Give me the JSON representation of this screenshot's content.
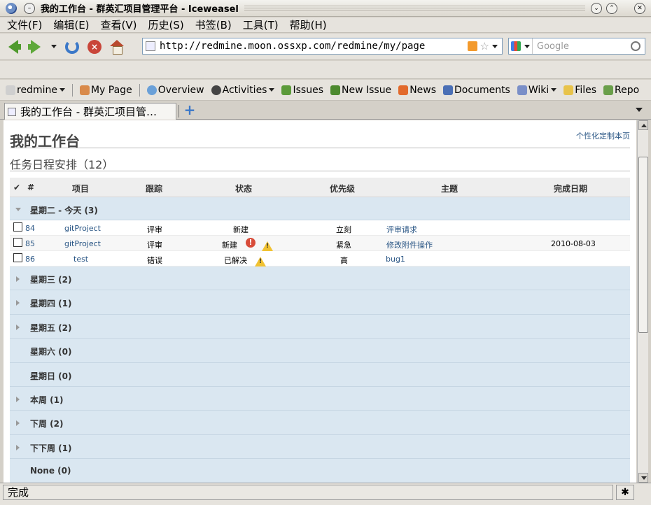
{
  "window": {
    "title": "我的工作台 - 群英汇项目管理平台 - Iceweasel"
  },
  "menubar": {
    "items": [
      "文件(F)",
      "编辑(E)",
      "查看(V)",
      "历史(S)",
      "书签(B)",
      "工具(T)",
      "帮助(H)"
    ]
  },
  "navbar": {
    "url": "http://redmine.moon.ossxp.com/redmine/my/page",
    "search_placeholder": "Google"
  },
  "bookmarks": {
    "items": [
      "redmine",
      "My Page",
      "Overview",
      "Activities",
      "Issues",
      "New Issue",
      "News",
      "Documents",
      "Wiki",
      "Files",
      "Repo"
    ]
  },
  "tabs": {
    "active_label": "我的工作台 - 群英汇项目管…"
  },
  "page": {
    "title": "我的工作台",
    "customize_link": "个性化定制本页",
    "section_title": "任务日程安排（12）"
  },
  "table": {
    "headers": {
      "id": "#",
      "project": "项目",
      "tracker": "跟踪",
      "status": "状态",
      "priority": "优先级",
      "subject": "主题",
      "due": "完成日期"
    },
    "today_group": "星期二 - 今天 (3)",
    "rows": [
      {
        "id": "84",
        "project": "gitProject",
        "tracker": "评审",
        "status": "新建",
        "priority": "立刻",
        "subject": "评审请求",
        "due": ""
      },
      {
        "id": "85",
        "project": "gitProject",
        "tracker": "评审",
        "status": "新建",
        "priority": "紧急",
        "subject": "修改附件操作",
        "due": "2010-08-03"
      },
      {
        "id": "86",
        "project": "test",
        "tracker": "错误",
        "status": "已解决",
        "priority": "高",
        "subject": "bug1",
        "due": ""
      }
    ],
    "groups": [
      "星期三 (2)",
      "星期四 (1)",
      "星期五 (2)",
      "星期六 (0)",
      "星期日 (0)",
      "本周 (1)",
      "下周 (2)",
      "下下周 (1)",
      "None (0)"
    ]
  },
  "status": {
    "text": "完成"
  }
}
